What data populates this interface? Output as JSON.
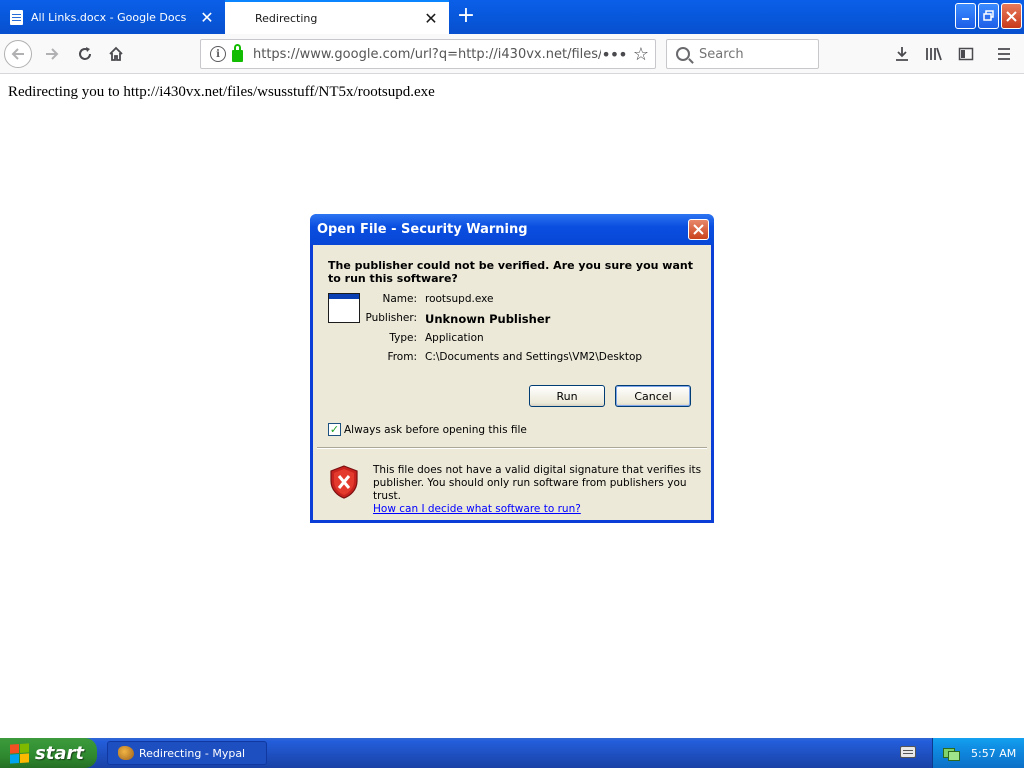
{
  "browser": {
    "tabs": [
      {
        "label": "All Links.docx - Google Docs",
        "active": false
      },
      {
        "label": "Redirecting",
        "active": true
      }
    ],
    "new_tab_glyph": "+",
    "close_glyph": "✕",
    "url": "https://www.google.com/url?q=http://i430vx.net/files/",
    "url_more_glyph": "•••",
    "search_placeholder": "Search"
  },
  "page": {
    "text": "Redirecting you to http://i430vx.net/files/wsusstuff/NT5x/rootsupd.exe"
  },
  "dialog": {
    "title": "Open File - Security Warning",
    "question": "The publisher could not be verified.  Are you sure you want to run this software?",
    "fields": [
      {
        "label": "Name:",
        "value": "rootsupd.exe"
      },
      {
        "label": "Publisher:",
        "value": "Unknown Publisher"
      },
      {
        "label": "Type:",
        "value": "Application"
      },
      {
        "label": "From:",
        "value": "C:\\Documents and Settings\\VM2\\Desktop"
      }
    ],
    "run_label": "Run",
    "cancel_label": "Cancel",
    "checkbox_label": "Always ask before opening this file",
    "checkbox_checked": true,
    "warning_text": "This file does not have a valid digital signature that verifies its publisher.  You should only run software from publishers you trust.",
    "warning_link": "How can I decide what software to run?"
  },
  "taskbar": {
    "start_label": "start",
    "task_label": "Redirecting - Mypal",
    "clock": "5:57 AM"
  },
  "colors": {
    "titlebar_blue": "#0a5fe8",
    "dialog_frame": "#0b3ed6",
    "dialog_body": "#ece9d8",
    "start_green": "#2f8a2f",
    "lock_green": "#12bc00"
  }
}
